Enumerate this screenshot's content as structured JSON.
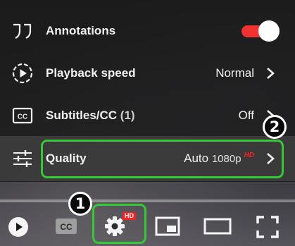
{
  "settings_menu": {
    "annotations": {
      "label": "Annotations",
      "enabled": true,
      "toggle_color": "#f03232"
    },
    "playback_speed": {
      "label": "Playback speed",
      "value": "Normal"
    },
    "subtitles": {
      "label": "Subtitles/CC",
      "count": "(1)",
      "value": "Off"
    },
    "quality": {
      "label": "Quality",
      "value": "Auto",
      "resolution": "1080p",
      "hd_tag": "HD"
    }
  },
  "player_controls": {
    "settings_hd_badge": "HD",
    "icons": [
      "play-icon",
      "subtitles-cc-icon",
      "settings-gear-icon",
      "miniplayer-icon",
      "theater-mode-icon",
      "fullscreen-icon"
    ]
  },
  "annotations_steps": {
    "step1": "1",
    "step2": "2",
    "highlight_color": "#35c935"
  }
}
